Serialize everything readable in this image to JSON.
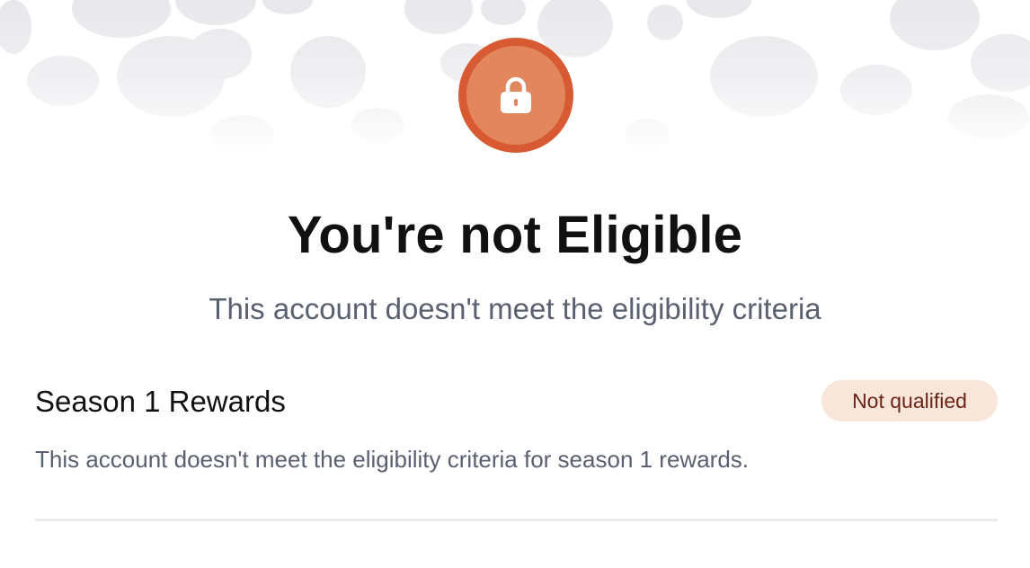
{
  "header": {
    "icon": "lock-icon",
    "accent_color": "#d85a32",
    "accent_light": "#e2865e",
    "title": "You're not Eligible",
    "subtitle": "This account doesn't meet the eligibility criteria"
  },
  "reward": {
    "title": "Season 1 Rewards",
    "status": "Not qualified",
    "status_bg": "#f7e6d9",
    "status_color": "#6b2417",
    "description": "This account doesn't meet the eligibility criteria for season 1 rewards."
  }
}
